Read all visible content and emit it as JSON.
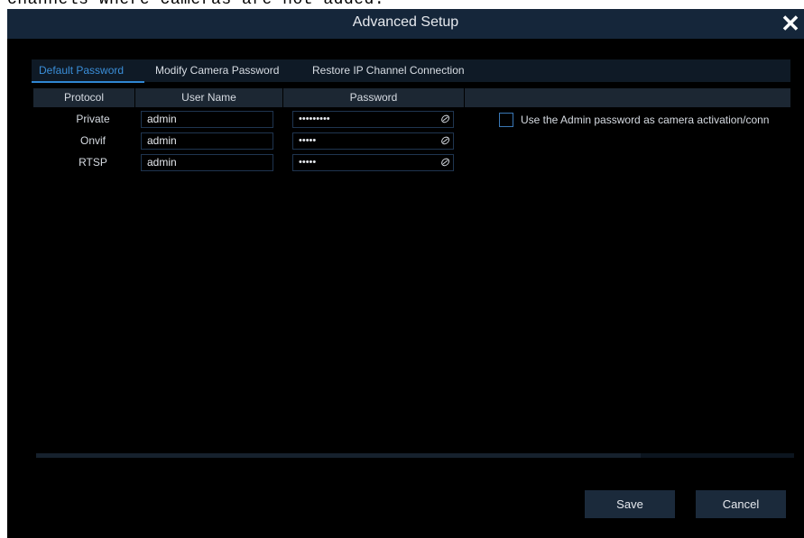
{
  "background_text": "channels where cameras are not added.",
  "window": {
    "title": "Advanced Setup",
    "close_symbol": "✕"
  },
  "tabs": [
    {
      "label": "Default Password",
      "active": true
    },
    {
      "label": "Modify Camera Password",
      "active": false
    },
    {
      "label": "Restore IP Channel Connection",
      "active": false
    }
  ],
  "table": {
    "headers": [
      "Protocol",
      "User Name",
      "Password"
    ],
    "rows": [
      {
        "protocol": "Private",
        "username": "admin",
        "password": "•••••••••"
      },
      {
        "protocol": "Onvif",
        "username": "admin",
        "password": "•••••"
      },
      {
        "protocol": "RTSP",
        "username": "admin",
        "password": "•••••"
      }
    ]
  },
  "option": {
    "label": "Use the Admin password as camera activation/conn",
    "checked": false
  },
  "buttons": {
    "save": "Save",
    "cancel": "Cancel"
  },
  "icons": {
    "password_visibility": "eye-slash-icon",
    "close": "close-icon"
  },
  "colors": {
    "accent": "#2f86d3",
    "titlebar": "#15263a",
    "background": "#000000"
  }
}
